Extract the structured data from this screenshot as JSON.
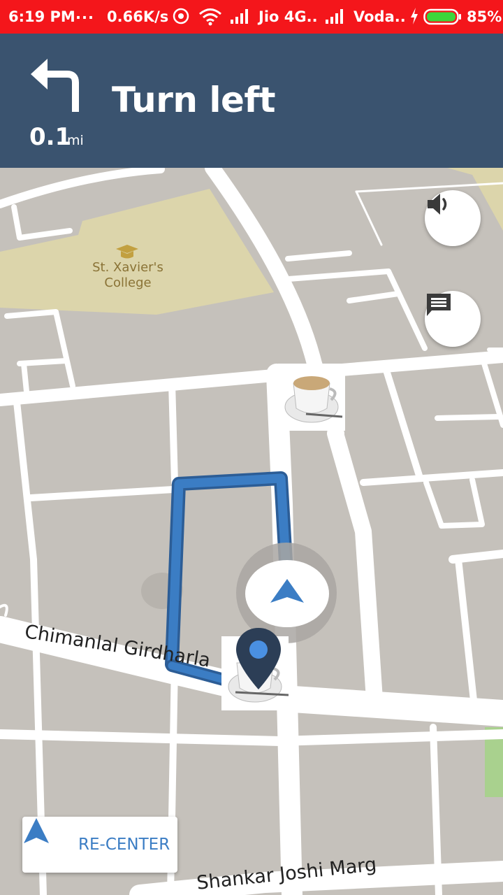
{
  "status_bar": {
    "time": "6:19 PM",
    "dots": "...",
    "speed": "0.66K/s",
    "carrier1": "Jio 4G..",
    "carrier2": "Voda..",
    "battery": "85%",
    "bg_color": "#f4161b"
  },
  "navigation": {
    "maneuver_icon": "turn-left-arrow-icon",
    "instruction": "Turn left",
    "distance_value": "0.1",
    "distance_unit": "mi",
    "header_color": "#3a536f"
  },
  "map": {
    "poi_college": "St. Xavier's\nCollege",
    "street_1": "Chimanlal Girdharla",
    "street_2": "Shankar Joshi Marg",
    "route_color": "#3b7dc4"
  },
  "controls": {
    "sound_icon": "volume-icon",
    "chat_icon": "message-icon",
    "recenter_label": "RE-CENTER"
  }
}
